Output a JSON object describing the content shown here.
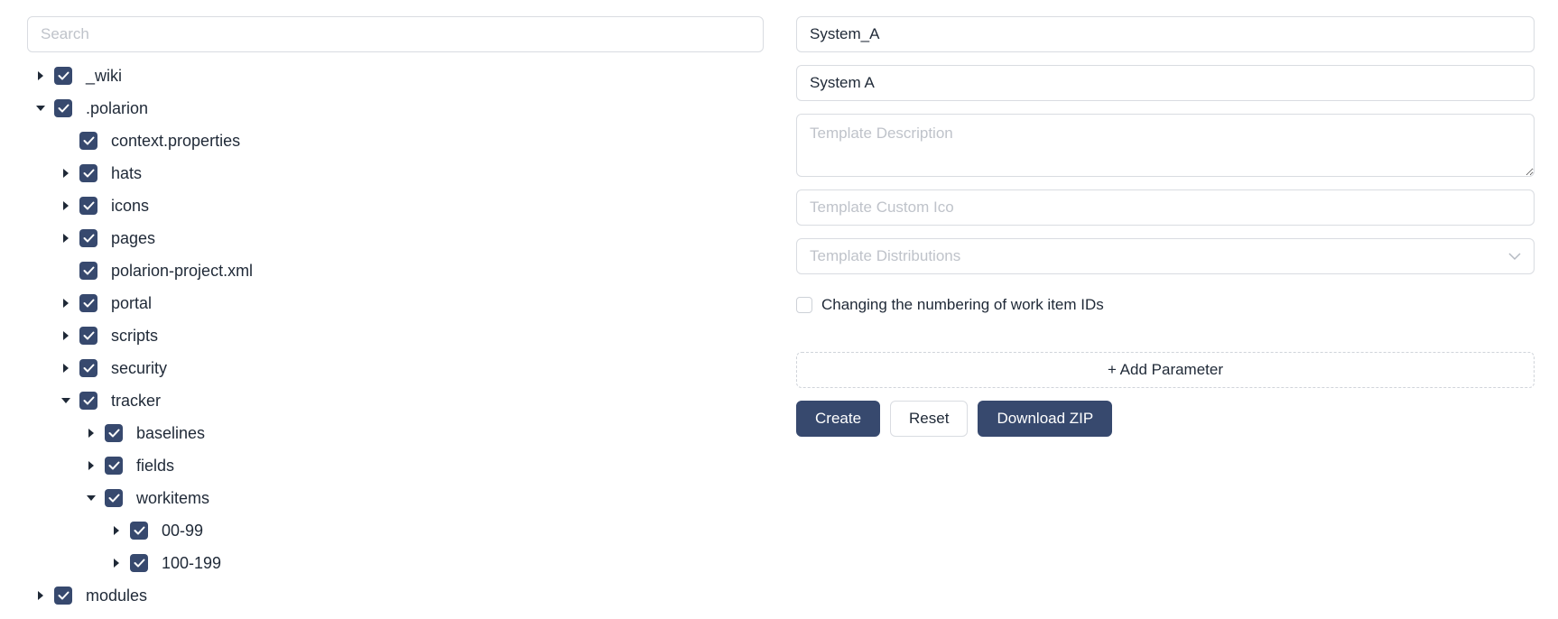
{
  "search": {
    "placeholder": "Search"
  },
  "tree": [
    {
      "label": "_wiki",
      "level": 0,
      "caret": "right",
      "checked": true
    },
    {
      "label": ".polarion",
      "level": 0,
      "caret": "down",
      "checked": true
    },
    {
      "label": "context.properties",
      "level": 1,
      "caret": "none",
      "checked": true
    },
    {
      "label": "hats",
      "level": 1,
      "caret": "right",
      "checked": true
    },
    {
      "label": "icons",
      "level": 1,
      "caret": "right",
      "checked": true
    },
    {
      "label": "pages",
      "level": 1,
      "caret": "right",
      "checked": true
    },
    {
      "label": "polarion-project.xml",
      "level": 1,
      "caret": "none",
      "checked": true
    },
    {
      "label": "portal",
      "level": 1,
      "caret": "right",
      "checked": true
    },
    {
      "label": "scripts",
      "level": 1,
      "caret": "right",
      "checked": true
    },
    {
      "label": "security",
      "level": 1,
      "caret": "right",
      "checked": true
    },
    {
      "label": "tracker",
      "level": 1,
      "caret": "down",
      "checked": true
    },
    {
      "label": "baselines",
      "level": 2,
      "caret": "right",
      "checked": true
    },
    {
      "label": "fields",
      "level": 2,
      "caret": "right",
      "checked": true
    },
    {
      "label": "workitems",
      "level": 2,
      "caret": "down",
      "checked": true
    },
    {
      "label": "00-99",
      "level": 3,
      "caret": "right",
      "checked": true
    },
    {
      "label": "100-199",
      "level": 3,
      "caret": "right",
      "checked": true
    },
    {
      "label": "modules",
      "level": 0,
      "caret": "right",
      "checked": true
    }
  ],
  "form": {
    "template_id": "System_A",
    "template_name": "System A",
    "description_placeholder": "Template Description",
    "custom_icon_placeholder": "Template Custom Ico",
    "distributions_placeholder": "Template Distributions",
    "renumber_label": "Changing the numbering of work item IDs",
    "add_parameter_label": "+ Add Parameter"
  },
  "buttons": {
    "create": "Create",
    "reset": "Reset",
    "download": "Download ZIP"
  },
  "colors": {
    "accent": "#37496e",
    "border": "#d9dce1",
    "placeholder": "#bfc3ca"
  }
}
